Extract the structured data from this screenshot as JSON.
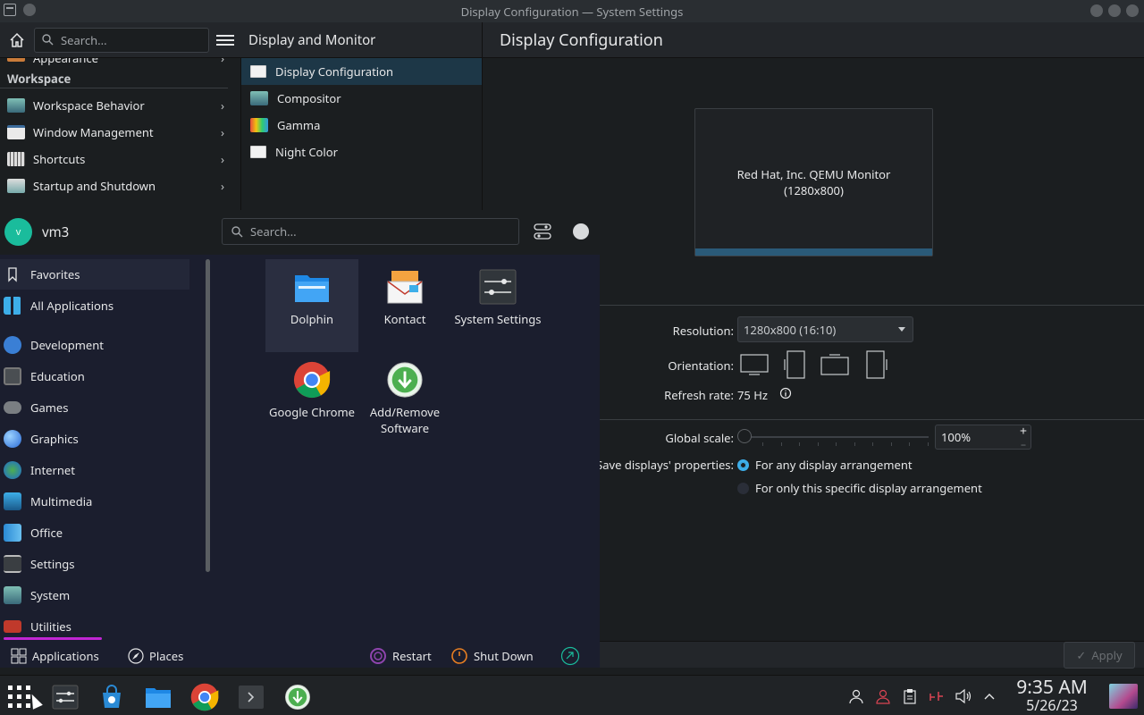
{
  "window": {
    "title": "Display Configuration — System Settings"
  },
  "settings_sidebar": {
    "search_placeholder": "Search...",
    "top_item": "Appearance",
    "section_title": "Workspace",
    "items": [
      {
        "label": "Workspace Behavior"
      },
      {
        "label": "Window Management"
      },
      {
        "label": "Shortcuts"
      },
      {
        "label": "Startup and Shutdown"
      }
    ]
  },
  "category": {
    "title": "Display and Monitor",
    "items": [
      {
        "label": "Display Configuration"
      },
      {
        "label": "Compositor"
      },
      {
        "label": "Gamma"
      },
      {
        "label": "Night Color"
      }
    ]
  },
  "main": {
    "title": "Display Configuration",
    "monitor_name": "Red Hat, Inc. QEMU Monitor",
    "monitor_res": "(1280x800)",
    "resolution_label": "Resolution:",
    "resolution_value": "1280x800 (16:10)",
    "orientation_label": "Orientation:",
    "refresh_label": "Refresh rate:",
    "refresh_value": "75 Hz",
    "scale_label": "Global scale:",
    "scale_value": "100%",
    "save_label": "Save displays' properties:",
    "save_opt1": "For any display arrangement",
    "save_opt2": "For only this specific display arrangement",
    "apply_label": "Apply"
  },
  "launcher": {
    "user": "vm3",
    "avatar_letter": "v",
    "search_placeholder": "Search...",
    "categories": [
      {
        "label": "Favorites"
      },
      {
        "label": "All Applications"
      },
      {
        "label": "Development"
      },
      {
        "label": "Education"
      },
      {
        "label": "Games"
      },
      {
        "label": "Graphics"
      },
      {
        "label": "Internet"
      },
      {
        "label": "Multimedia"
      },
      {
        "label": "Office"
      },
      {
        "label": "Settings"
      },
      {
        "label": "System"
      },
      {
        "label": "Utilities"
      }
    ],
    "apps": [
      {
        "label": "Dolphin"
      },
      {
        "label": "Kontact"
      },
      {
        "label": "System Settings"
      },
      {
        "label": "Google Chrome"
      },
      {
        "label": "Add/Remove Software"
      }
    ],
    "bottom": {
      "applications": "Applications",
      "places": "Places",
      "restart": "Restart",
      "shutdown": "Shut Down"
    }
  },
  "taskbar": {
    "time": "9:35 AM",
    "date": "5/26/23"
  },
  "colors": {
    "accent": "#3daee9",
    "highlight": "#1d3747"
  }
}
